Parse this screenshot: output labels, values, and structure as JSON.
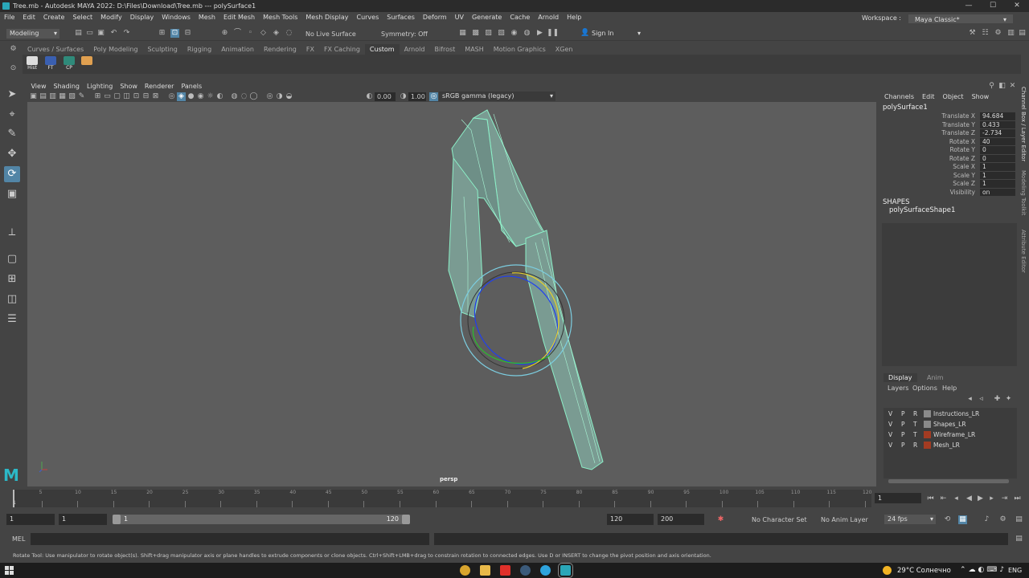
{
  "window": {
    "title": "Tree.mb - Autodesk MAYA 2022: D:\\Files\\Download\\Tree.mb  ---  polySurface1",
    "min": "—",
    "max": "☐",
    "close": "✕"
  },
  "menubar": {
    "items": [
      "File",
      "Edit",
      "Create",
      "Select",
      "Modify",
      "Display",
      "Windows",
      "Mesh",
      "Edit Mesh",
      "Mesh Tools",
      "Mesh Display",
      "Curves",
      "Surfaces",
      "Deform",
      "UV",
      "Generate",
      "Cache",
      "Arnold",
      "Help"
    ],
    "workspace_label": "Workspace :",
    "workspace_value": "Maya Classic*"
  },
  "statusline": {
    "mode": "Modeling",
    "live_surface": "No Live Surface",
    "symmetry": "Symmetry: Off",
    "sign_in": "Sign In"
  },
  "shelf": {
    "tabs": [
      "Curves / Surfaces",
      "Poly Modeling",
      "Sculpting",
      "Rigging",
      "Animation",
      "Rendering",
      "FX",
      "FX Caching",
      "Custom",
      "Arnold",
      "Bifrost",
      "MASH",
      "Motion Graphics",
      "XGen"
    ],
    "active_tab": "Custom",
    "buttons": [
      "Hist",
      "FT",
      "CP",
      ""
    ]
  },
  "panel": {
    "menu": [
      "View",
      "Shading",
      "Lighting",
      "Show",
      "Renderer",
      "Panels"
    ],
    "exposure": "0.00",
    "gamma": "1.00",
    "colorspace": "sRGB gamma (legacy)",
    "camera": "persp"
  },
  "channelbox": {
    "menu": [
      "Channels",
      "Edit",
      "Object",
      "Show"
    ],
    "object": "polySurface1",
    "attributes": [
      {
        "name": "Translate X",
        "value": "94.684"
      },
      {
        "name": "Translate Y",
        "value": "0.433"
      },
      {
        "name": "Translate Z",
        "value": "-2.734"
      },
      {
        "name": "Rotate X",
        "value": "40"
      },
      {
        "name": "Rotate Y",
        "value": "0"
      },
      {
        "name": "Rotate Z",
        "value": "0"
      },
      {
        "name": "Scale X",
        "value": "1"
      },
      {
        "name": "Scale Y",
        "value": "1"
      },
      {
        "name": "Scale Z",
        "value": "1"
      },
      {
        "name": "Visibility",
        "value": "on"
      }
    ],
    "shapes_header": "SHAPES",
    "shape": "polySurfaceShape1"
  },
  "sidetabs": [
    "Channel Box / Layer Editor",
    "Modeling Toolkit",
    "Attribute Editor"
  ],
  "layereditor": {
    "tabs": [
      "Display",
      "Anim"
    ],
    "active_tab": "Display",
    "menu": [
      "Layers",
      "Options",
      "Help"
    ],
    "layers": [
      {
        "v": "V",
        "p": "P",
        "t": "R",
        "name": "Instructions_LR",
        "color": "#8a8a8a"
      },
      {
        "v": "V",
        "p": "P",
        "t": "T",
        "name": "Shapes_LR",
        "color": "#8a8a8a"
      },
      {
        "v": "V",
        "p": "P",
        "t": "T",
        "name": "Wireframe_LR",
        "color": "#a33b22"
      },
      {
        "v": "V",
        "p": "P",
        "t": "R",
        "name": "Mesh_LR",
        "color": "#a33b22"
      }
    ]
  },
  "timeline": {
    "ticks": [
      "5",
      "10",
      "15",
      "20",
      "25",
      "30",
      "35",
      "40",
      "45",
      "50",
      "55",
      "60",
      "65",
      "70",
      "75",
      "80",
      "85",
      "90",
      "95",
      "100",
      "105",
      "110",
      "115",
      "120"
    ],
    "current_frame": "1",
    "first_tick": "1"
  },
  "range": {
    "start": "1",
    "start2": "1",
    "slider_start": "1",
    "slider_end": "120",
    "end": "120",
    "end2": "200",
    "char_set": "No Character Set",
    "anim_layer": "No Anim Layer",
    "fps": "24 fps"
  },
  "mel": {
    "label": "MEL"
  },
  "helpline": "Rotate Tool: Use manipulator to rotate object(s). Shift+drag manipulator axis or plane handles to extrude components or clone objects. Ctrl+Shift+LMB+drag to constrain rotation to connected edges. Use D or INSERT to change the pivot position and axis orientation.",
  "taskbar": {
    "weather": "29°C  Солнечно",
    "lang": "ENG"
  },
  "colors": {
    "viewport": "#5d5d5d",
    "mesh": "#8cd6bb",
    "accent": "#5285a6"
  }
}
